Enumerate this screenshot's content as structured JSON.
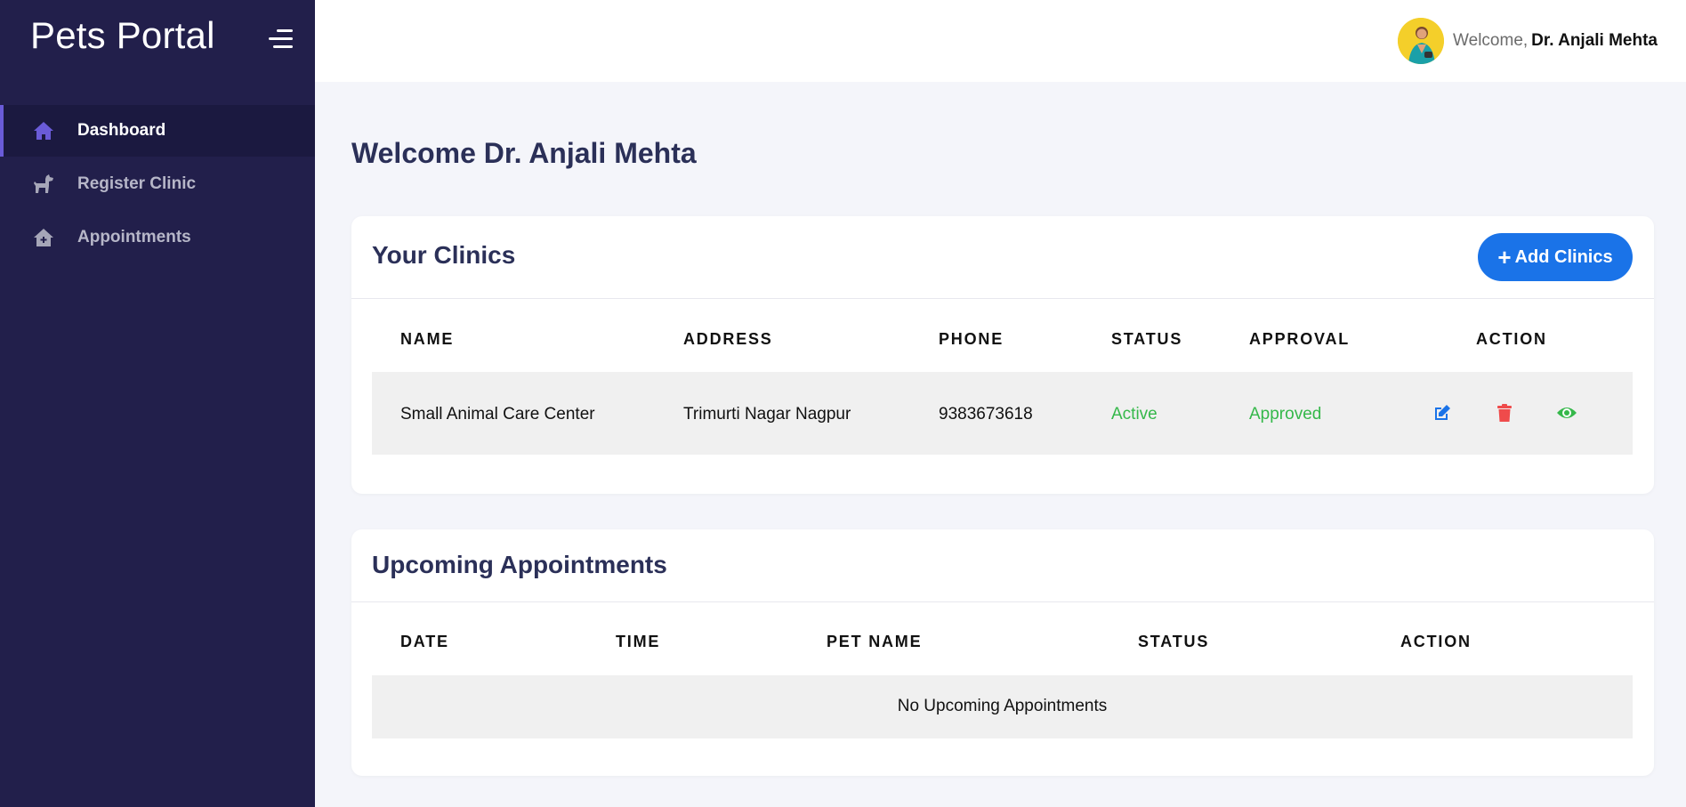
{
  "sidebar": {
    "brand": "Pets Portal",
    "items": [
      {
        "label": "Dashboard",
        "icon": "home-icon",
        "active": true
      },
      {
        "label": "Register Clinic",
        "icon": "dog-icon",
        "active": false
      },
      {
        "label": "Appointments",
        "icon": "clinic-house-icon",
        "active": false
      }
    ]
  },
  "topbar": {
    "welcome_prefix": "Welcome,",
    "user_name": "Dr. Anjali Mehta"
  },
  "main": {
    "title": "Welcome Dr. Anjali Mehta",
    "clinics": {
      "title": "Your Clinics",
      "add_button": "Add Clinics",
      "columns": [
        "NAME",
        "ADDRESS",
        "PHONE",
        "STATUS",
        "APPROVAL",
        "ACTION"
      ],
      "rows": [
        {
          "name": "Small Animal Care Center",
          "address": "Trimurti Nagar Nagpur",
          "phone": "9383673618",
          "status": "Active",
          "approval": "Approved",
          "actions": [
            "edit-icon",
            "delete-icon",
            "view-icon"
          ]
        }
      ]
    },
    "appointments": {
      "title": "Upcoming Appointments",
      "columns": [
        "DATE",
        "TIME",
        "PET NAME",
        "STATUS",
        "ACTION"
      ],
      "empty_message": "No Upcoming Appointments"
    }
  },
  "colors": {
    "sidebar_bg": "#221f4b",
    "accent": "#6a5bd8",
    "primary_button": "#1a73e8",
    "status_green": "#35b84a",
    "delete_red": "#ef4b4b"
  }
}
